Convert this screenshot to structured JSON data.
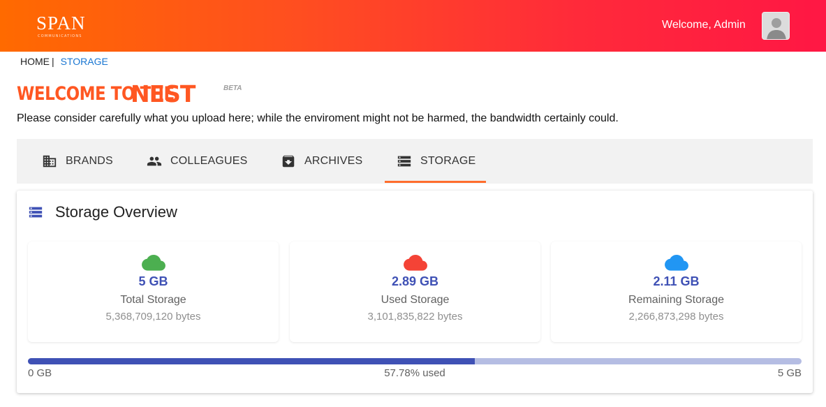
{
  "header": {
    "logo_text": "SPAN",
    "logo_subtitle": "COMMUNICATIONS",
    "welcome_text": "Welcome, Admin",
    "avatar_icon": "user-avatar-icon",
    "colors": {
      "gradient_start": "#ff6a00",
      "gradient_end": "#ff1744"
    }
  },
  "breadcrumb": {
    "home": "HOME",
    "separator": "|",
    "current": "STORAGE"
  },
  "hero": {
    "welcome": "WELCOME TO THE",
    "nest": "NEST",
    "beta": "BETA",
    "notice": "Please consider carefully what you upload here; while the enviroment might not be harmed, the bandwidth certainly could."
  },
  "tabs": [
    {
      "label": "BRANDS",
      "icon": "building-icon",
      "active": false
    },
    {
      "label": "COLLEAGUES",
      "icon": "people-icon",
      "active": false
    },
    {
      "label": "ARCHIVES",
      "icon": "archive-icon",
      "active": false
    },
    {
      "label": "STORAGE",
      "icon": "storage-icon",
      "active": true
    }
  ],
  "overview": {
    "title": "Storage Overview",
    "icon": "storage-list-icon",
    "stats": [
      {
        "value": "5 GB",
        "label": "Total Storage",
        "bytes": "5,368,709,120 bytes",
        "icon": "cloud-icon",
        "color": "#4caf50"
      },
      {
        "value": "2.89 GB",
        "label": "Used Storage",
        "bytes": "3,101,835,822 bytes",
        "icon": "cloud-icon",
        "color": "#f44336"
      },
      {
        "value": "2.11 GB",
        "label": "Remaining Storage",
        "bytes": "2,266,873,298 bytes",
        "icon": "cloud-icon",
        "color": "#2196f3"
      }
    ],
    "progress": {
      "fraction_used": 0.5778,
      "min_label": "0 GB",
      "used_label": "57.78% used",
      "max_label": "5 GB",
      "fill_color": "#3f51b5",
      "track_color": "#b5bde3"
    }
  }
}
